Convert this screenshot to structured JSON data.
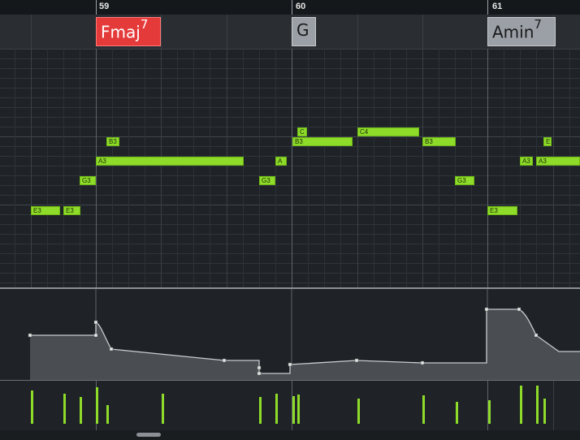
{
  "ruler": {
    "bar_59": "59",
    "bar_60": "60",
    "bar_61": "61"
  },
  "chords": [
    {
      "root": "Fmaj",
      "ext": "7",
      "color": "#e53a3a"
    },
    {
      "root": "G",
      "ext": "",
      "color": "#9aa0a6"
    },
    {
      "root": "Amin",
      "ext": "7",
      "color": "#9aa0a6"
    }
  ],
  "notes": [
    "E3",
    "E3",
    "G3",
    "A3",
    "B3",
    "A",
    "G3",
    "C",
    "B3",
    "C4",
    "B3",
    "G3",
    "E3",
    "A3",
    "A3",
    "E"
  ],
  "colors": {
    "note": "#8edb2a",
    "background": "#1f2327"
  }
}
